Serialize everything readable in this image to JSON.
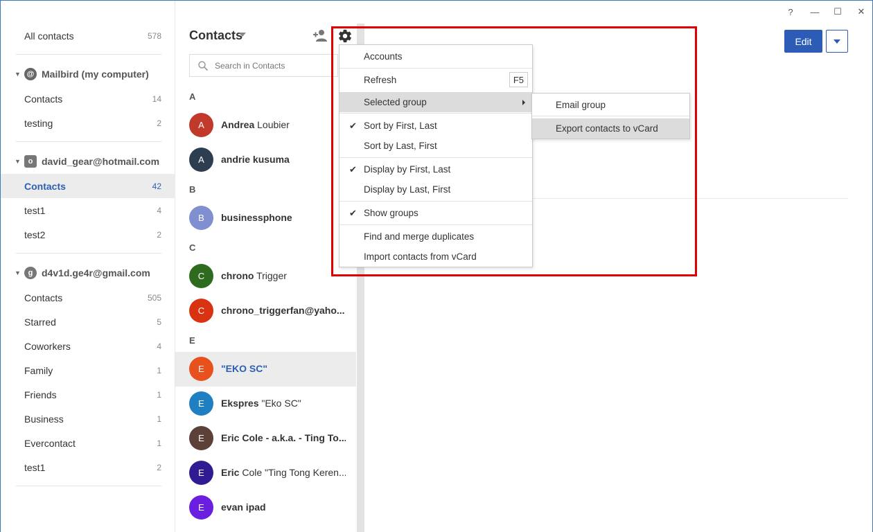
{
  "colors": {
    "accent": "#2d5cb7",
    "highlight_box": "#e00000",
    "selected_bg": "#ececec"
  },
  "window": {
    "help": "?",
    "minimize": "—",
    "maximize": "☐",
    "close": "✕"
  },
  "sidebar": {
    "all_contacts": {
      "label": "All contacts",
      "count": "578"
    },
    "accounts": [
      {
        "name": "Mailbird (my computer)",
        "icon": "mailbird-icon",
        "groups": [
          {
            "label": "Contacts",
            "count": "14"
          },
          {
            "label": "testing",
            "count": "2"
          }
        ]
      },
      {
        "name": "david_gear@hotmail.com",
        "icon": "outlook-icon",
        "groups": [
          {
            "label": "Contacts",
            "count": "42"
          },
          {
            "label": "test1",
            "count": "4"
          },
          {
            "label": "test2",
            "count": "2"
          }
        ]
      },
      {
        "name": "d4v1d.ge4r@gmail.com",
        "icon": "google-icon",
        "groups": [
          {
            "label": "Contacts",
            "count": "505"
          },
          {
            "label": "Starred",
            "count": "5"
          },
          {
            "label": "Coworkers",
            "count": "4"
          },
          {
            "label": "Family",
            "count": "1"
          },
          {
            "label": "Friends",
            "count": "1"
          },
          {
            "label": "Business",
            "count": "1"
          },
          {
            "label": "Evercontact",
            "count": "1"
          },
          {
            "label": "test1",
            "count": "2"
          }
        ]
      }
    ]
  },
  "contacts": {
    "title": "Contacts",
    "search_placeholder": "Search in Contacts",
    "letters": [
      "A",
      "B",
      "C",
      "E"
    ],
    "items": [
      {
        "initial": "A",
        "bold": "Andrea",
        "rest": " Loubier",
        "color": "#c0392b"
      },
      {
        "initial": "A",
        "bold": "andrie kusuma",
        "rest": "",
        "color": "#2c3e50"
      },
      {
        "initial": "B",
        "bold": "businessphone",
        "rest": "",
        "color": "#7f8fd0"
      },
      {
        "initial": "C",
        "bold": "chrono",
        "rest": " Trigger",
        "color": "#2e6b1f"
      },
      {
        "initial": "C",
        "bold": "chrono_triggerfan@yaho...",
        "rest": "",
        "color": "#d93210"
      },
      {
        "initial": "E",
        "bold": "\"EKO SC\"",
        "rest": "",
        "color": "#e8501e"
      },
      {
        "initial": "E",
        "bold": "Ekspres",
        "rest": " \"Eko SC\"",
        "color": "#1e7fc1"
      },
      {
        "initial": "E",
        "bold": "Eric Cole - a.k.a. - Ting To...",
        "rest": "",
        "color": "#5d4037"
      },
      {
        "initial": "E",
        "bold": "Eric",
        "rest": " Cole \"Ting Tong Keren...",
        "color": "#311b92"
      },
      {
        "initial": "E",
        "bold": "evan ipad",
        "rest": "",
        "color": "#6a1ee0"
      }
    ]
  },
  "detail": {
    "edit_label": "Edit"
  },
  "menu": {
    "accounts": "Accounts",
    "refresh": "Refresh",
    "refresh_key": "F5",
    "selected_group": "Selected group",
    "sort_first_last": "Sort by First, Last",
    "sort_last_first": "Sort by Last, First",
    "display_first_last": "Display by First, Last",
    "display_last_first": "Display by Last, First",
    "show_groups": "Show groups",
    "find_merge": "Find and merge duplicates",
    "import_vcard": "Import contacts from vCard",
    "check": "✔"
  },
  "submenu": {
    "email_group": "Email group",
    "export_vcard": "Export contacts to vCard"
  }
}
